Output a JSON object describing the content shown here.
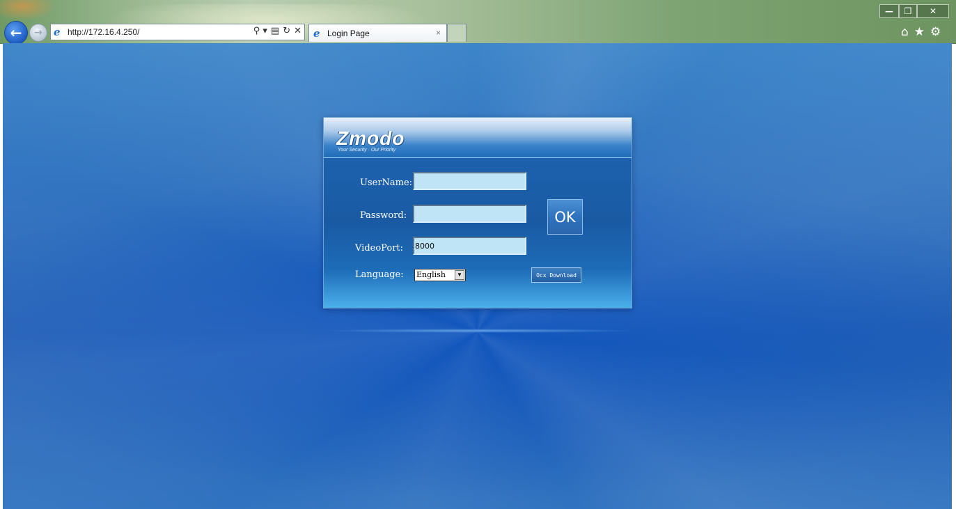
{
  "browser": {
    "url": "http://172.16.4.250/",
    "tab_title": "Login Page",
    "tab_close": "×",
    "back_icon": "←",
    "forward_icon": "→",
    "ie_icon_glyph": "e",
    "address_tools": {
      "search": "⚲ ▾",
      "compat": "▤",
      "refresh": "↻",
      "stop": "✕"
    },
    "window_controls": {
      "minimize": "—",
      "maximize": "❐",
      "close": "✕"
    },
    "tools": {
      "home": "⌂",
      "favorites": "★",
      "settings": "⚙"
    }
  },
  "login": {
    "logo": "Zmodo",
    "tagline": "Your Security · Our Priority",
    "username_label": "UserName:",
    "password_label": "Password:",
    "videoport_label": "VideoPort:",
    "language_label": "Language:",
    "username_value": "",
    "password_value": "",
    "videoport_value": "8000",
    "language_value": "English",
    "language_arrow": "▼",
    "ok_label": "OK",
    "ocx_label": "Ocx Download"
  }
}
